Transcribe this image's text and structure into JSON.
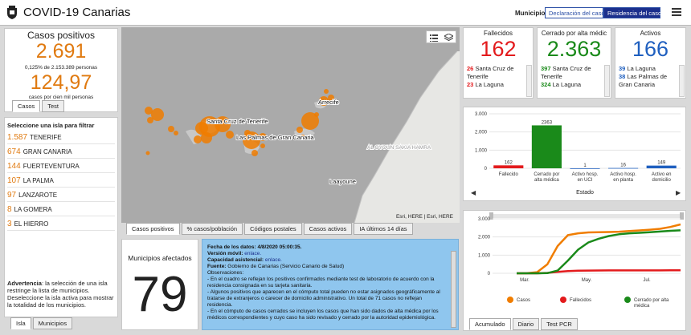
{
  "header": {
    "title": "COVID-19 Canarias",
    "municipio_label": "Municipio",
    "btn_declaracion": "Declaración del caso",
    "btn_residencia": "Residencia del caso"
  },
  "casos": {
    "title": "Casos positivos",
    "total": "2.691",
    "pct": "0,125% de 2.153.389 personas",
    "rate": "124,97",
    "rate_label": "casos por cien mil personas",
    "tabs": [
      "Casos",
      "Test"
    ]
  },
  "islas": {
    "title": "Seleccione una isla para filtrar",
    "items": [
      {
        "n": "1.587",
        "name": "TENERIFE"
      },
      {
        "n": "674",
        "name": "GRAN CANARIA"
      },
      {
        "n": "144",
        "name": "FUERTEVENTURA"
      },
      {
        "n": "107",
        "name": "LA PALMA"
      },
      {
        "n": "97",
        "name": "LANZAROTE"
      },
      {
        "n": "8",
        "name": "LA GOMERA"
      },
      {
        "n": "3",
        "name": "EL HIERRO"
      }
    ],
    "warning_bold": "Advertencia",
    "warning": ": la selección de una isla restringe la lista de municipios. Deseleccione la isla activa para mostrar la totalidad de los municipios.",
    "tabs": [
      "Isla",
      "Municipios"
    ]
  },
  "map": {
    "labels": [
      "Santa Cruz de Tenerife",
      "Las Palmas de Gran Canaria",
      "Arrecife",
      "AL OYOUN SAKIA HAMRA",
      "Laayoune"
    ],
    "attribution": "Esri, HERE | Esri, HERE",
    "tabs": [
      "Casos positivos",
      "% casos/población",
      "Códigos postales",
      "Casos activos",
      "IA últimos 14 días"
    ]
  },
  "municipios": {
    "title": "Municipios afectados",
    "count": "79"
  },
  "notes": {
    "fecha_label": "Fecha de los datos:",
    "fecha": " 4/8/2020 05:00:35.",
    "version_label": "Versión móvil:",
    "version": " enlace.",
    "capacidad_label": "Capacidad asistencial:",
    "capacidad": " enlace.",
    "fuente_label": "Fuente:",
    "fuente": " Gobierno de Canarias (Servicio Canario de Salud)",
    "obs_label": "Observaciones:",
    "obs1": "- En el cuadro se reflejan los positivos confirmados mediante test de laboratorio de acuerdo con la residencia consignada en su tarjeta sanitaria.",
    "obs2": "- Algunos positivos que aparecen en el cómputo total pueden no estar asignados geográficamente al tratarse de extranjeros o carecer de domicilio administrativo. Un total de 71 casos no reflejan residencia.",
    "obs3": "- En el cómputo de casos cerrados se incluyen los casos que han sido dados de alta médica por los médicos correspondientes y cuyo caso ha sido revisado y cerrado por la autoridad epidemiológica."
  },
  "fallecidos": {
    "title": "Fallecidos",
    "total": "162",
    "color": "#e31a1c",
    "list": [
      {
        "n": "26",
        "name": "Santa Cruz de Tenerife"
      },
      {
        "n": "23",
        "name": "La Laguna"
      }
    ]
  },
  "cerrados": {
    "title": "Cerrado por alta médic",
    "total": "2.363",
    "color": "#1a8a1a",
    "list": [
      {
        "n": "397",
        "name": "Santa Cruz de Tenerife"
      },
      {
        "n": "324",
        "name": "La Laguna"
      }
    ]
  },
  "activos": {
    "title": "Activos",
    "total": "166",
    "color": "#1f5fbf",
    "list": [
      {
        "n": "39",
        "name": "La Laguna"
      },
      {
        "n": "38",
        "name": "Las Palmas de Gran Canaria"
      }
    ]
  },
  "chart_data": [
    {
      "type": "bar",
      "categories": [
        "Fallecido",
        "Cerrado por alta médica",
        "Activo hosp. en UCI",
        "Activo hosp. en planta",
        "Activo en domicilio"
      ],
      "values": [
        162,
        2363,
        1,
        16,
        149
      ],
      "colors": [
        "#e31a1c",
        "#1a8a1a",
        "#1f5fbf",
        "#1f5fbf",
        "#1f5fbf"
      ],
      "xlabel": "Estado",
      "ylim": [
        0,
        3000
      ],
      "yticks": [
        "3.000",
        "2.000",
        "1.000",
        "0"
      ]
    },
    {
      "type": "line",
      "xticks": [
        "Mar.",
        "May.",
        "Jul."
      ],
      "yticks": [
        "3.000",
        "2.000",
        "1.000",
        "0"
      ],
      "ylim": [
        0,
        3000
      ],
      "series": [
        {
          "name": "Casos",
          "color": "#f07d00",
          "values": [
            0,
            5,
            60,
            500,
            1500,
            2100,
            2200,
            2250,
            2260,
            2270,
            2290,
            2330,
            2360,
            2400,
            2450,
            2550,
            2691
          ]
        },
        {
          "name": "Fallecidos",
          "color": "#e31a1c",
          "values": [
            0,
            0,
            2,
            20,
            80,
            120,
            140,
            150,
            155,
            158,
            159,
            160,
            160,
            161,
            161,
            162,
            162
          ]
        },
        {
          "name": "Cerrado por alta médica",
          "color": "#1a8a1a",
          "values": [
            0,
            0,
            0,
            10,
            150,
            700,
            1300,
            1700,
            1900,
            2050,
            2150,
            2200,
            2230,
            2260,
            2300,
            2340,
            2363
          ]
        }
      ]
    }
  ],
  "bottom_tabs": [
    "Acumulado",
    "Diario",
    "Test PCR"
  ]
}
